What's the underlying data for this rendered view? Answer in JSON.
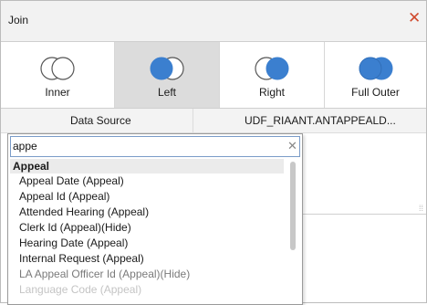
{
  "dialog": {
    "title": "Join",
    "close_icon": "close-icon",
    "close_color": "#d04a2e"
  },
  "join_types": [
    {
      "label": "Inner",
      "icon": "inner-join-icon",
      "selected": false
    },
    {
      "label": "Left",
      "icon": "left-join-icon",
      "selected": true
    },
    {
      "label": "Right",
      "icon": "right-join-icon",
      "selected": false
    },
    {
      "label": "Full Outer",
      "icon": "full-outer-join-icon",
      "selected": false
    }
  ],
  "colors": {
    "venn_fill": "#3b7fcf",
    "venn_stroke": "#555555",
    "selected_bg": "#dcdcdc"
  },
  "table_header": {
    "left": "Data Source",
    "right": "UDF_RIAANT.ANTAPPEALD..."
  },
  "field_search": {
    "value": "appe",
    "clear_icon": "clear-icon",
    "group": "Appeal",
    "items": [
      "Appeal Date (Appeal)",
      "Appeal Id (Appeal)",
      "Attended Hearing (Appeal)",
      "Clerk Id (Appeal)(Hide)",
      "Hearing Date (Appeal)",
      "Internal Request (Appeal)",
      "LA Appeal Officer Id (Appeal)(Hide)",
      "Language Code (Appeal)"
    ]
  }
}
